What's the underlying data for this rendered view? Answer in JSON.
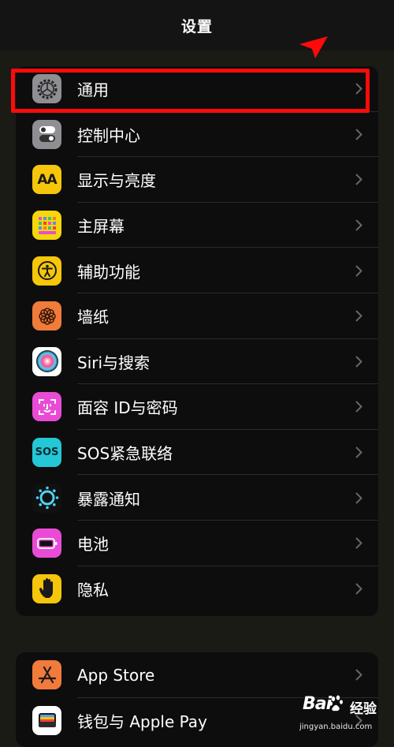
{
  "nav": {
    "title": "设置"
  },
  "group1": {
    "items": [
      {
        "label": "通用",
        "icon": "gear-icon",
        "color": "#8e8e93"
      },
      {
        "label": "控制中心",
        "icon": "toggles-icon",
        "color": "#8e8e93"
      },
      {
        "label": "显示与亮度",
        "icon": "text-size-icon",
        "color": "#f5c60a"
      },
      {
        "label": "主屏幕",
        "icon": "app-grid-icon",
        "color": "#f5d70a"
      },
      {
        "label": "辅助功能",
        "icon": "accessibility-icon",
        "color": "#f5c60a"
      },
      {
        "label": "墙纸",
        "icon": "flower-icon",
        "color": "#f07b3a"
      },
      {
        "label": "Siri与搜索",
        "icon": "siri-icon",
        "color": "#ffffff"
      },
      {
        "label": "面容 ID与密码",
        "icon": "face-id-icon",
        "color": "#e94bd6"
      },
      {
        "label": "SOS紧急联络",
        "icon": "sos-icon",
        "color": "#24c7d6",
        "icon_text": "SOS"
      },
      {
        "label": "暴露通知",
        "icon": "exposure-icon",
        "color": "#111111"
      },
      {
        "label": "电池",
        "icon": "battery-icon",
        "color": "#e94bd6"
      },
      {
        "label": "隐私",
        "icon": "hand-icon",
        "color": "#f5c60a"
      }
    ]
  },
  "group2": {
    "items": [
      {
        "label": "App Store",
        "icon": "app-store-icon",
        "color": "#f07b3a"
      },
      {
        "label": "钱包与 Apple Pay",
        "icon": "wallet-icon",
        "color": "#ffffff"
      }
    ]
  },
  "watermark": {
    "main": "Bai",
    "suffix": "经验",
    "sub": "jingyan.baidu.com"
  },
  "accent_highlight": "#ff0a0a"
}
